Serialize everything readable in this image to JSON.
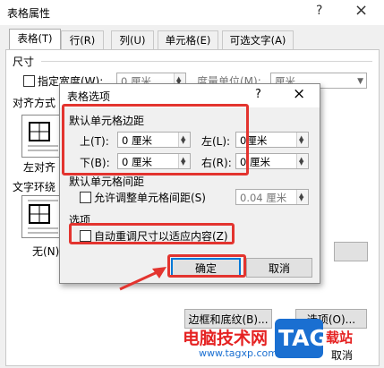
{
  "outer": {
    "title": "表格属性",
    "help": "?",
    "close": "×",
    "tabs": [
      {
        "label": "表格(T)"
      },
      {
        "label": "行(R)"
      },
      {
        "label": "列(U)"
      },
      {
        "label": "单元格(E)"
      },
      {
        "label": "可选文字(A)"
      }
    ],
    "size_section": "尺寸",
    "preferred_width_label": "指定宽度(W):",
    "preferred_width_value": "0 厘米",
    "measure_label": "度量单位(M):",
    "measure_value": "厘米",
    "alignment_section": "对齐方式",
    "align_left_label": "左对齐",
    "wrap_section": "文字环绕",
    "wrap_none_label": "无(N)",
    "borders_button": "边框和底纹(B)...",
    "options_button": "选项(O)...",
    "cancel_label": "取消"
  },
  "dialog": {
    "title": "表格选项",
    "help": "?",
    "close": "×",
    "margins_section": "默认单元格边距",
    "top_label": "上(T):",
    "top_value": "0 厘米",
    "left_label": "左(L):",
    "left_value": "0厘米",
    "bottom_label": "下(B):",
    "bottom_value": "0 厘米",
    "right_label": "右(R):",
    "right_value": "0 厘米",
    "spacing_section": "默认单元格间距",
    "allow_spacing_label": "允许调整单元格间距(S)",
    "spacing_value": "0.04 厘米",
    "options_section": "选项",
    "autoresize_label": "自动重调尺寸以适应内容(Z)",
    "ok": "确定",
    "cancel": "取消"
  },
  "watermark": {
    "site_name": "电脑技术网",
    "url": "www.tagxp.com",
    "logo": "TAG",
    "logo_sub": "载站"
  },
  "colors": {
    "highlight_red": "#e3342f",
    "watermark_red": "#e52222",
    "watermark_blue": "#1a6fd1"
  }
}
